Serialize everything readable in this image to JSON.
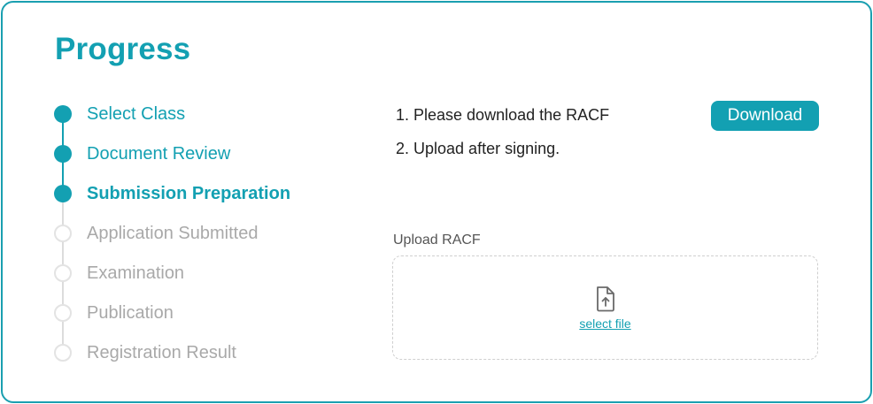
{
  "title": "Progress",
  "steps": [
    {
      "label": "Select Class",
      "status": "done"
    },
    {
      "label": "Document Review",
      "status": "done"
    },
    {
      "label": "Submission Preparation",
      "status": "active"
    },
    {
      "label": "Application Submitted",
      "status": "todo"
    },
    {
      "label": "Examination",
      "status": "todo"
    },
    {
      "label": "Publication",
      "status": "todo"
    },
    {
      "label": "Registration Result",
      "status": "todo"
    }
  ],
  "instructions": [
    "1.  Please download the RACF",
    "2.  Upload after signing."
  ],
  "download_button": "Download",
  "upload": {
    "label": "Upload RACF",
    "link": "select file",
    "icon": "file-upload-icon"
  },
  "colors": {
    "accent": "#13a0b2",
    "inactive": "#a9a9a9",
    "border": "#1a9fb0"
  }
}
